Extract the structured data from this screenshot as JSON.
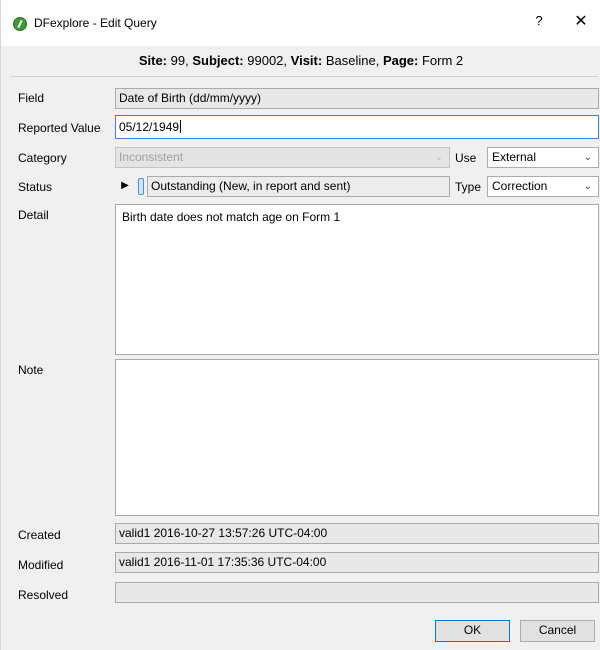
{
  "window": {
    "title": "DFexplore - Edit Query",
    "help_glyph": "?",
    "close_glyph": "✕"
  },
  "context": {
    "site_label": "Site:",
    "site_value": "99,",
    "subject_label": "Subject:",
    "subject_value": "99002,",
    "visit_label": "Visit:",
    "visit_value": "Baseline,",
    "page_label": "Page:",
    "page_value": "Form 2"
  },
  "form": {
    "field_label": "Field",
    "field_value": "Date of Birth (dd/mm/yyyy)",
    "reported_label": "Reported Value",
    "reported_value": "05/12/1949",
    "category_label": "Category",
    "category_value": "Inconsistent",
    "use_label": "Use",
    "use_value": "External",
    "status_label": "Status",
    "status_value": "Outstanding (New, in report and sent)",
    "type_label": "Type",
    "type_value": "Correction",
    "detail_label": "Detail",
    "detail_value": "Birth date does not match age on Form 1",
    "note_label": "Note",
    "note_value": "",
    "created_label": "Created",
    "created_value": "valid1 2016-10-27 13:57:26 UTC-04:00",
    "modified_label": "Modified",
    "modified_value": "valid1 2016-11-01 17:35:36 UTC-04:00",
    "resolved_label": "Resolved",
    "resolved_value": ""
  },
  "buttons": {
    "ok": "OK",
    "cancel": "Cancel"
  },
  "colors": {
    "focus_border": "#3c84d2",
    "default_button_border": "#0078d7",
    "app_icon": "#3d9a35"
  },
  "icons": {
    "app": "dfexplore-logo-icon",
    "status_play": "play-icon",
    "dropdown": "chevron-down-icon"
  }
}
